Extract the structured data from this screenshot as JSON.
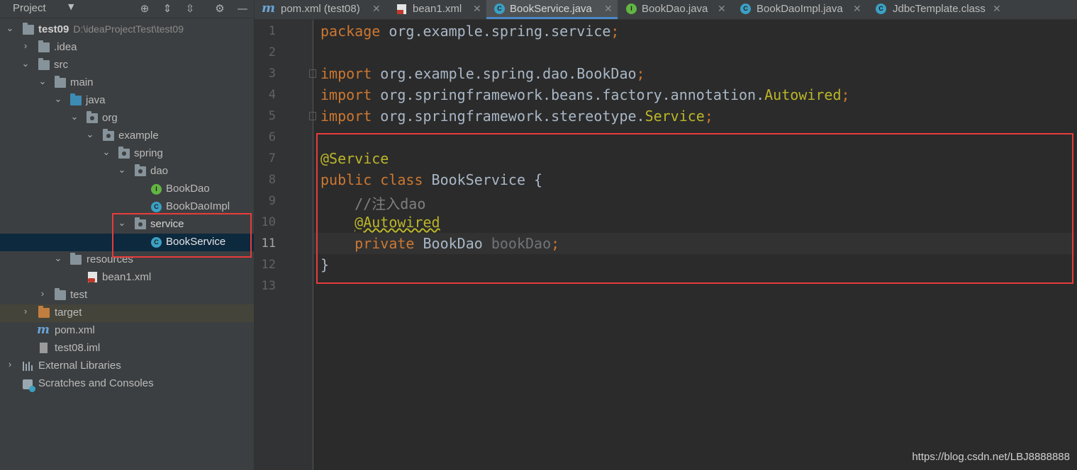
{
  "sidebar": {
    "title": "Project",
    "tree": [
      {
        "label": "test09",
        "path": "D:\\ideaProjectTest\\test09"
      },
      {
        "label": ".idea"
      },
      {
        "label": "src"
      },
      {
        "label": "main"
      },
      {
        "label": "java"
      },
      {
        "label": "org"
      },
      {
        "label": "example"
      },
      {
        "label": "spring"
      },
      {
        "label": "dao"
      },
      {
        "label": "BookDao"
      },
      {
        "label": "BookDaoImpl"
      },
      {
        "label": "service"
      },
      {
        "label": "BookService"
      },
      {
        "label": "resources"
      },
      {
        "label": "bean1.xml"
      },
      {
        "label": "test"
      },
      {
        "label": "target"
      },
      {
        "label": "pom.xml"
      },
      {
        "label": "test08.iml"
      },
      {
        "label": "External Libraries"
      },
      {
        "label": "Scratches and Consoles"
      }
    ]
  },
  "tabs": [
    {
      "label": "pom.xml (test08)",
      "icon": "maven-icon"
    },
    {
      "label": "bean1.xml",
      "icon": "xml-icon"
    },
    {
      "label": "BookService.java",
      "icon": "class-icon",
      "active": true
    },
    {
      "label": "BookDao.java",
      "icon": "interface-icon"
    },
    {
      "label": "BookDaoImpl.java",
      "icon": "class-icon"
    },
    {
      "label": "JdbcTemplate.class",
      "icon": "class-icon"
    }
  ],
  "editor": {
    "line_numbers": [
      "1",
      "2",
      "3",
      "4",
      "5",
      "6",
      "7",
      "8",
      "9",
      "10",
      "11",
      "12",
      "13"
    ],
    "current_line": "11",
    "code": {
      "l1": {
        "kw": "package",
        "rest": " org.example.spring.service",
        "semi": ";"
      },
      "l3": {
        "kw": "import",
        "rest": " org.example.spring.dao.BookDao",
        "semi": ";"
      },
      "l4": {
        "kw": "import",
        "rest": " org.springframework.beans.factory.annotation.",
        "ann": "Autowired",
        "semi": ";"
      },
      "l5": {
        "kw": "import",
        "rest": " org.springframework.stereotype.",
        "ann": "Service",
        "semi": ";"
      },
      "l7": {
        "ann": "@Service"
      },
      "l8": {
        "kw": "public class",
        "rest": " BookService {"
      },
      "l9": {
        "comment": "//注入dao"
      },
      "l10": {
        "ann": "@Autowired"
      },
      "l11": {
        "kw": "private",
        "type": " BookDao ",
        "var": "bookDao",
        "semi": ";"
      },
      "l12": {
        "text": "}"
      }
    }
  },
  "watermark": "https://blog.csdn.net/LBJ8888888",
  "colors": {
    "keyword": "#cc7832",
    "annotation": "#bbb529",
    "comment": "#808080",
    "highlight_box": "#e83b3b",
    "selection": "#0d293e"
  }
}
